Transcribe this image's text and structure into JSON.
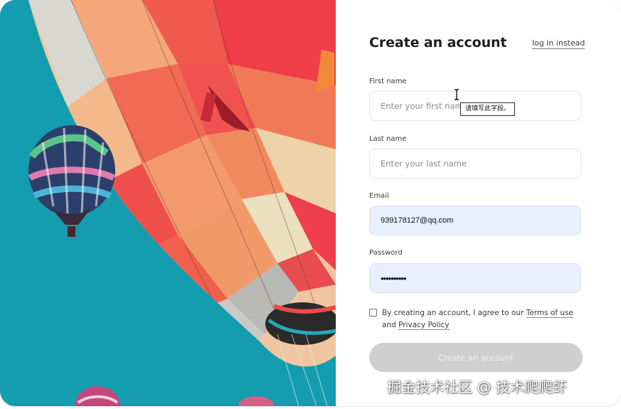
{
  "form": {
    "title": "Create an account",
    "login_link": "log in instead",
    "first_name": {
      "label": "First name",
      "placeholder": "Enter your first name",
      "value": ""
    },
    "last_name": {
      "label": "Last name",
      "placeholder": "Enter your last name",
      "value": ""
    },
    "email": {
      "label": "Email",
      "value": "939178127@qq.com"
    },
    "password": {
      "label": "Password",
      "value": "••••••••••"
    },
    "agreement": {
      "prefix": "By creating an account, I agree to our ",
      "terms_link": "Terms of use",
      "middle": " and ",
      "privacy_link": "Privacy Policy",
      "checked": false
    },
    "submit_label": "Create an account"
  },
  "tooltip": "请填写此字段。",
  "watermark": "掘金技术社区 @ 技术爬爬虾",
  "icons": {
    "cursor": "text-cursor-icon",
    "checkbox": "checkbox-icon"
  },
  "colors": {
    "sky": "#1aa3b5",
    "filled_field": "#e8f0fe",
    "button_disabled": "#cfcfcf"
  }
}
